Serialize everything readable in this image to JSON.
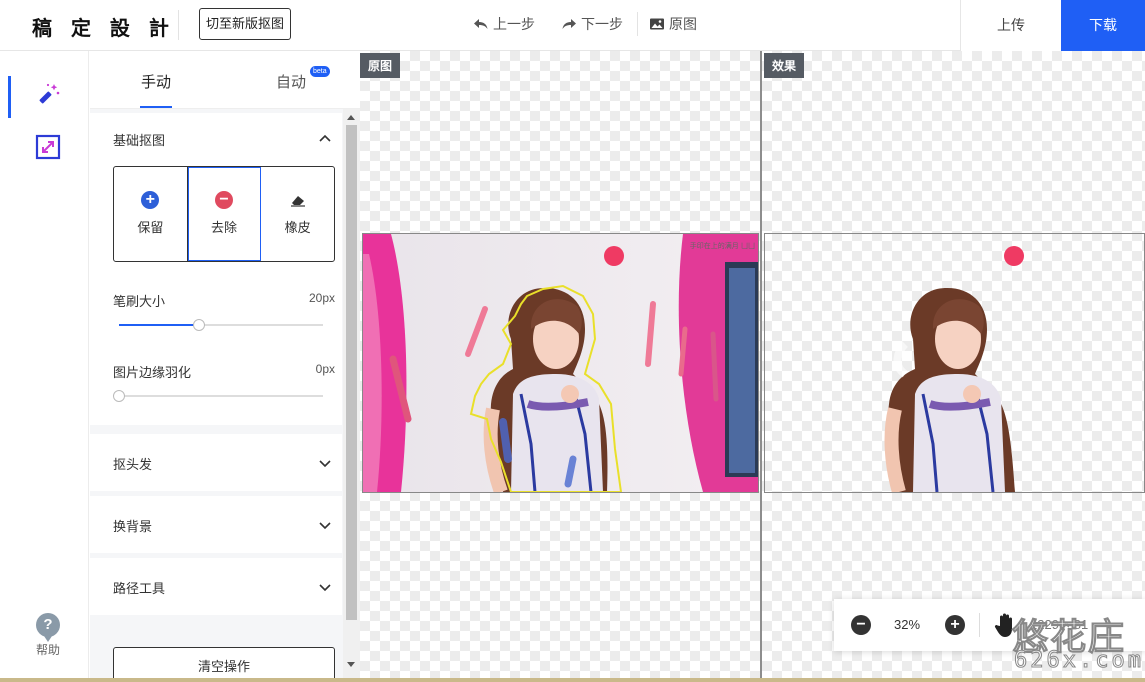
{
  "header": {
    "logo": "稿 定 設 計",
    "switch_label": "切至新版抠图",
    "undo_label": "上一步",
    "redo_label": "下一步",
    "original_label": "原图",
    "upload_label": "上传",
    "download_label": "下载"
  },
  "rail": {
    "items": [
      {
        "icon": "magic-wand-icon"
      },
      {
        "icon": "resize-icon"
      }
    ],
    "help_label": "帮助"
  },
  "panel": {
    "tabs": [
      {
        "label": "手动",
        "active": true
      },
      {
        "label": "自动",
        "active": false,
        "badge": "beta"
      }
    ],
    "basic": {
      "title": "基础抠图",
      "brushes": [
        {
          "label": "保留",
          "icon": "plus-circle-icon",
          "color": "#2d5fd8"
        },
        {
          "label": "去除",
          "icon": "minus-circle-icon",
          "color": "#e04a5f"
        },
        {
          "label": "橡皮",
          "icon": "eraser-icon",
          "color": "#333333"
        }
      ],
      "brush_size_label": "笔刷大小",
      "brush_size_value": "20px",
      "brush_size_fraction": 0.39,
      "feather_label": "图片边缘羽化",
      "feather_value": "0px",
      "feather_fraction": 0
    },
    "sections": [
      {
        "title": "抠头发"
      },
      {
        "title": "换背景"
      },
      {
        "title": "路径工具"
      }
    ],
    "clear_label": "清空操作"
  },
  "canvas": {
    "left_tag": "原图",
    "right_tag": "效果",
    "photo_caption": "手印在上的满月 凵凵"
  },
  "zoom": {
    "value": "32%",
    "dims": "1229 × 81"
  },
  "watermark": {
    "text": "悠花庄",
    "url": "626x.com"
  },
  "colors": {
    "accent": "#1f5ff5",
    "keep": "#2d5fd8",
    "remove": "#e04a5f"
  }
}
